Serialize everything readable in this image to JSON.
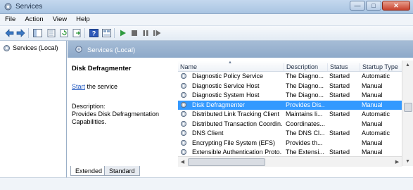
{
  "window": {
    "title": "Services",
    "buttons": {
      "minimize": "—",
      "maximize": "□",
      "close": "✕"
    }
  },
  "menu": [
    "File",
    "Action",
    "View",
    "Help"
  ],
  "tree": {
    "root_label": "Services (Local)"
  },
  "pane": {
    "header_label": "Services (Local)",
    "selected_service_name": "Disk Defragmenter",
    "start_link": "Start",
    "start_suffix": " the service",
    "description_label": "Description:",
    "description_text": "Provides Disk Defragmentation Capabilities."
  },
  "columns": [
    "Name",
    "Description",
    "Status",
    "Startup Type"
  ],
  "rows": [
    {
      "name": "Diagnostic Policy Service",
      "description": "The Diagno...",
      "status": "Started",
      "startup": "Automatic"
    },
    {
      "name": "Diagnostic Service Host",
      "description": "The Diagno...",
      "status": "Started",
      "startup": "Manual"
    },
    {
      "name": "Diagnostic System Host",
      "description": "The Diagno...",
      "status": "Started",
      "startup": "Manual"
    },
    {
      "name": "Disk Defragmenter",
      "description": "Provides Dis...",
      "status": "",
      "startup": "Manual",
      "selected": true
    },
    {
      "name": "Distributed Link Tracking Client",
      "description": "Maintains li...",
      "status": "Started",
      "startup": "Automatic"
    },
    {
      "name": "Distributed Transaction Coordin...",
      "description": "Coordinates...",
      "status": "",
      "startup": "Manual"
    },
    {
      "name": "DNS Client",
      "description": "The DNS Cl...",
      "status": "Started",
      "startup": "Automatic"
    },
    {
      "name": "Encrypting File System (EFS)",
      "description": "Provides th...",
      "status": "",
      "startup": "Manual"
    },
    {
      "name": "Extensible Authentication Proto...",
      "description": "The Extensi...",
      "status": "Started",
      "startup": "Manual"
    }
  ],
  "tabs": [
    "Extended",
    "Standard"
  ],
  "colors": {
    "selection": "#3399ff",
    "pane_header": "#9bb3d0",
    "link": "#1f57c1"
  }
}
